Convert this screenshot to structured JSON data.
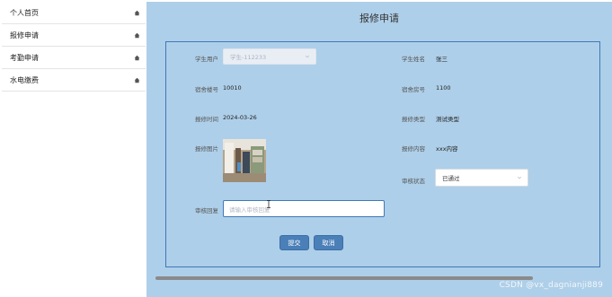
{
  "sidebar": {
    "items": [
      {
        "label": "个人首页",
        "icon": "home-icon"
      },
      {
        "label": "报修申请",
        "icon": "home-icon"
      },
      {
        "label": "考勤申请",
        "icon": "home-icon"
      },
      {
        "label": "水电缴费",
        "icon": "home-icon"
      }
    ]
  },
  "page": {
    "title": "报修申请"
  },
  "form": {
    "student_user": {
      "label": "学生用户",
      "value": "学生-112233"
    },
    "student_name": {
      "label": "学生姓名",
      "value": "张三"
    },
    "building_no": {
      "label": "宿舍楼号",
      "value": "10010"
    },
    "room_no": {
      "label": "宿舍房号",
      "value": "1100"
    },
    "repair_time": {
      "label": "报修时间",
      "value": "2024-03-26"
    },
    "repair_type": {
      "label": "报修类型",
      "value": "测试类型"
    },
    "repair_image": {
      "label": "报修图片"
    },
    "repair_content": {
      "label": "报修内容",
      "value": "xxx内容"
    },
    "review_status": {
      "label": "审核状态",
      "value": "已通过"
    },
    "review_reply": {
      "label": "审核回复",
      "placeholder": "请输入审核回复"
    }
  },
  "buttons": {
    "submit": "提交",
    "cancel": "取消"
  },
  "watermark": "CSDN @vx_dagnianji889",
  "colors": {
    "main_bg": "#aecfe9",
    "border_accent": "#3f78b8",
    "button_bg": "#4a7fb8"
  }
}
